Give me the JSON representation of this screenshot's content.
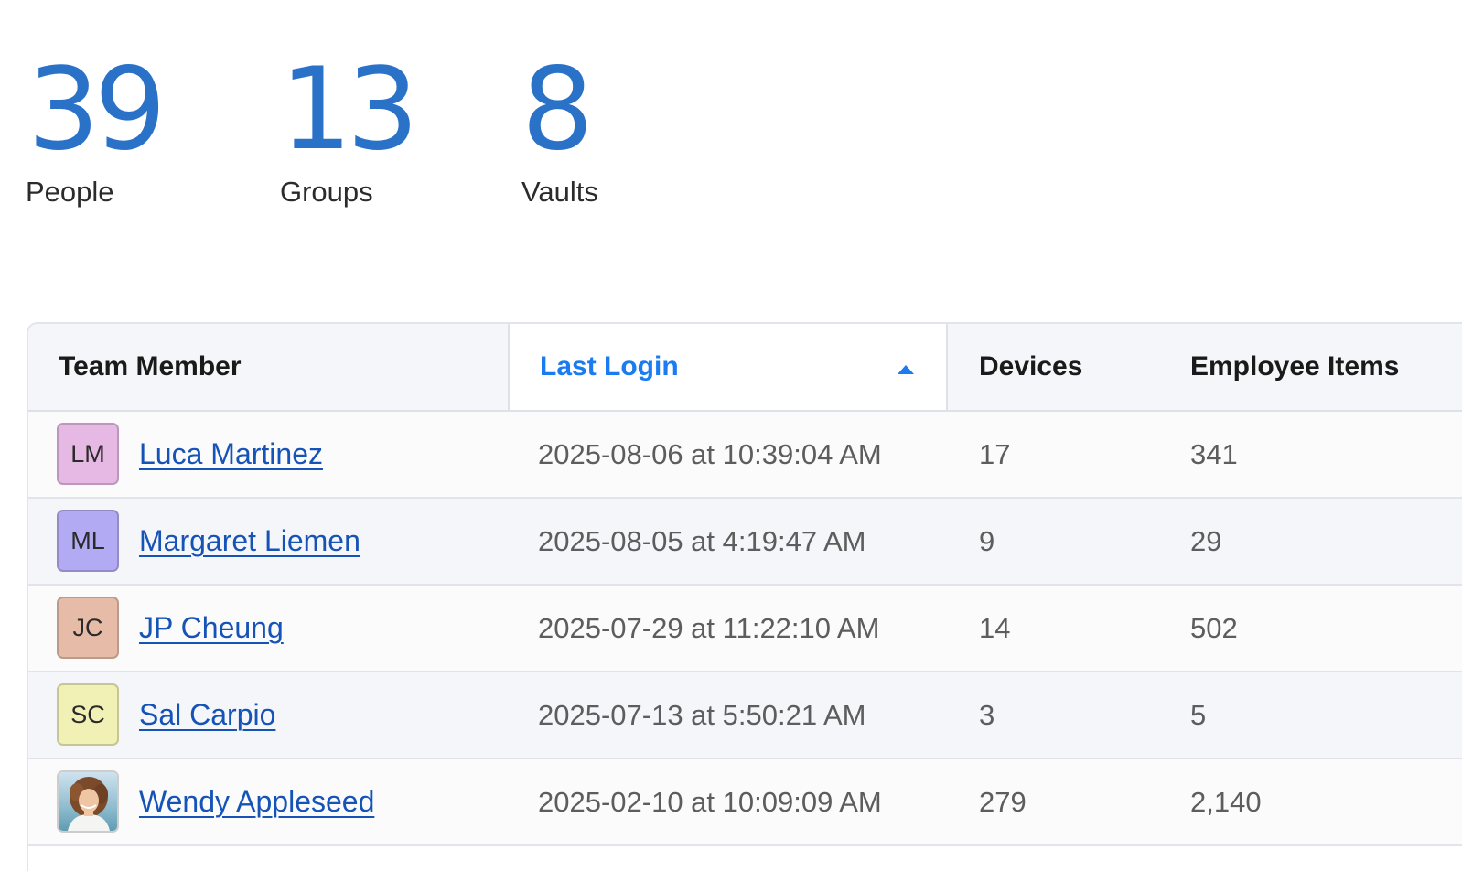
{
  "stats": {
    "people": {
      "value": "39",
      "label": "People"
    },
    "groups": {
      "value": "13",
      "label": "Groups"
    },
    "vaults": {
      "value": "8",
      "label": "Vaults"
    }
  },
  "table": {
    "columns": {
      "member": "Team Member",
      "last_login": "Last Login",
      "devices": "Devices",
      "items": "Employee Items"
    },
    "sort": {
      "column": "Last Login",
      "direction": "ascending",
      "icon": "sort-up-icon"
    },
    "rows": [
      {
        "initials": "LM",
        "avatar_color": "#e6b8e4",
        "name": "Luca Martinez",
        "last_login": "2025-08-06 at 10:39:04 AM",
        "devices": "17",
        "items": "341"
      },
      {
        "initials": "ML",
        "avatar_color": "#b2aaf2",
        "name": "Margaret Liemen",
        "last_login": "2025-08-05 at 4:19:47 AM",
        "devices": "9",
        "items": "29"
      },
      {
        "initials": "JC",
        "avatar_color": "#e6bca8",
        "name": "JP Cheung",
        "last_login": "2025-07-29 at 11:22:10 AM",
        "devices": "14",
        "items": "502"
      },
      {
        "initials": "SC",
        "avatar_color": "#f1f1b6",
        "name": "Sal Carpio",
        "last_login": "2025-07-13 at 5:50:21 AM",
        "devices": "3",
        "items": "5"
      },
      {
        "initials": "",
        "avatar_color": "",
        "avatar_icon": "user-photo-icon",
        "name": "Wendy Appleseed",
        "last_login": "2025-02-10 at 10:09:09 AM",
        "devices": "279",
        "items": "2,140"
      }
    ]
  },
  "colors": {
    "stat_value": "#2a72c7",
    "link": "#1553b6",
    "sorted_header": "#1a7cf0"
  }
}
